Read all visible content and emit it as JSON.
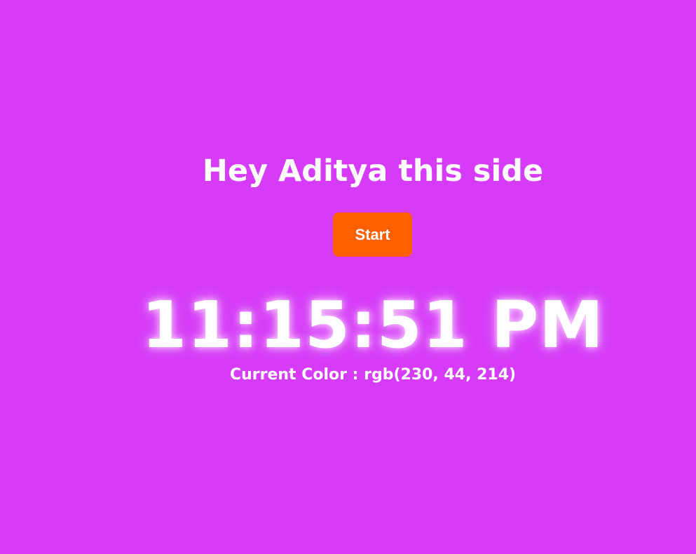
{
  "page": {
    "background_color": "#d63cf7",
    "heading": "Hey Aditya this side",
    "start_button": {
      "label": "Start",
      "color": "#ff5f00"
    },
    "clock": {
      "time": "11:15:51 PM"
    },
    "color_info": {
      "label": "Current Color :",
      "value": "rgb(230, 44, 214)"
    }
  }
}
